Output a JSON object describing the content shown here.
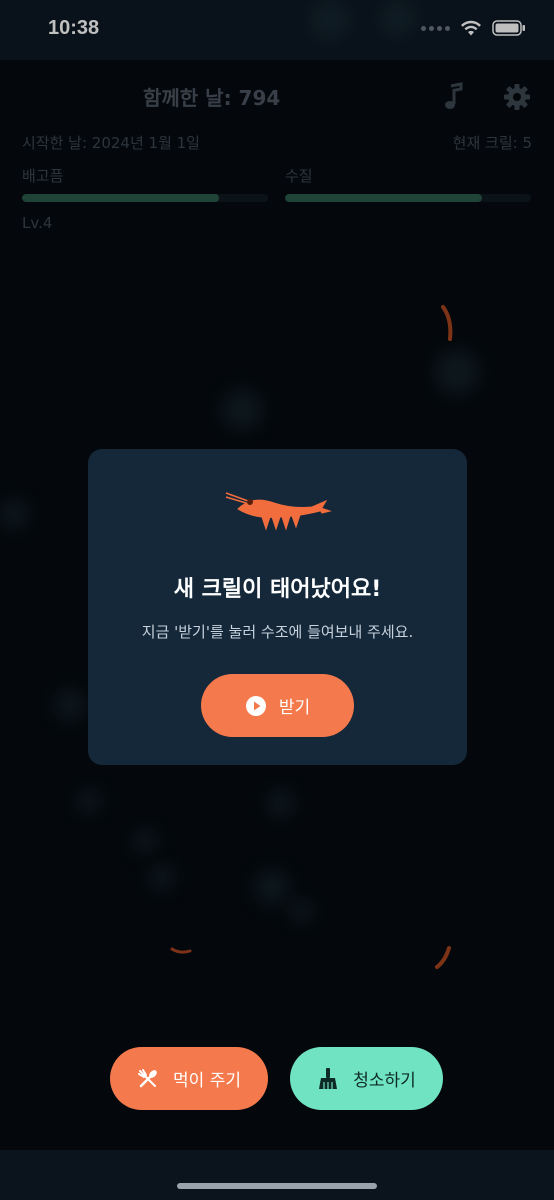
{
  "status": {
    "time": "10:38"
  },
  "header": {
    "days_together": "함께한 날: 794",
    "start_date": "시작한 날: 2024년 1월 1일",
    "krill_count": "현재 크릴: 5",
    "level": "Lv.4"
  },
  "gauges": {
    "hunger": {
      "label": "배고픔",
      "fill": 0.8
    },
    "water": {
      "label": "수질",
      "fill": 0.8
    }
  },
  "modal": {
    "title": "새 크릴이 태어났어요!",
    "message": "지금 '받기'를 눌러 수조에 들여보내 주세요.",
    "receive_label": "받기"
  },
  "actions": {
    "feed_label": "먹이 주기",
    "clean_label": "청소하기"
  },
  "colors": {
    "accent_orange": "#f47a4d",
    "accent_mint": "#6fe3c2",
    "modal_bg": "#14283a"
  },
  "icons": [
    "music-icon",
    "gear-icon",
    "wifi-icon",
    "battery-icon",
    "shrimp-icon",
    "play-icon",
    "utensils-icon",
    "broom-icon"
  ]
}
